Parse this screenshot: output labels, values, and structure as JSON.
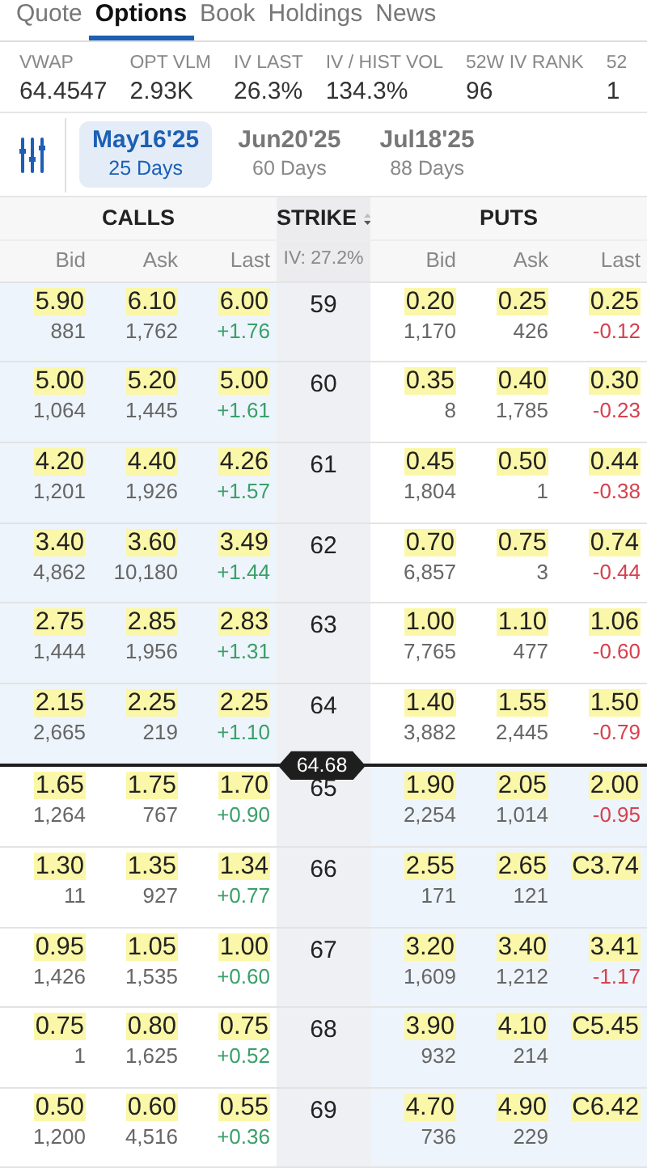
{
  "tabs": [
    {
      "label": "Quote",
      "selected": false
    },
    {
      "label": "Options",
      "selected": true
    },
    {
      "label": "Book",
      "selected": false
    },
    {
      "label": "Holdings",
      "selected": false
    },
    {
      "label": "News",
      "selected": false
    }
  ],
  "stats": [
    {
      "label": "VWAP",
      "value": "64.4547"
    },
    {
      "label": "OPT VLM",
      "value": "2.93K"
    },
    {
      "label": "IV LAST",
      "value": "26.3%"
    },
    {
      "label": "IV / HIST VOL",
      "value": "134.3%"
    },
    {
      "label": "52W IV RANK",
      "value": "96"
    },
    {
      "label": "52",
      "value": "1"
    }
  ],
  "expirations": [
    {
      "date": "May16'25",
      "days": "25 Days",
      "selected": true
    },
    {
      "date": "Jun20'25",
      "days": "60 Days",
      "selected": false
    },
    {
      "date": "Jul18'25",
      "days": "88 Days",
      "selected": false
    }
  ],
  "chain": {
    "calls_label": "CALLS",
    "strike_label": "STRIKE",
    "puts_label": "PUTS",
    "call_columns": [
      "Bid",
      "Ask",
      "Last"
    ],
    "iv": "IV: 27.2%",
    "put_columns": [
      "Bid",
      "Ask",
      "Last"
    ],
    "rows": [
      {
        "strike": "59",
        "call": {
          "bid": "5.90",
          "ask": "6.10",
          "last": "6.00",
          "bid_size": "881",
          "ask_size": "1,762",
          "change": {
            "text": "+1.76",
            "color": "#3aa06a"
          },
          "in_the_money": true
        },
        "put": {
          "bid": "0.20",
          "ask": "0.25",
          "last": "0.25",
          "bid_size": "1,170",
          "ask_size": "426",
          "change": {
            "text": "-0.12",
            "color": "#d6424f"
          },
          "in_the_money": false
        }
      },
      {
        "strike": "60",
        "call": {
          "bid": "5.00",
          "ask": "5.20",
          "last": "5.00",
          "bid_size": "1,064",
          "ask_size": "1,445",
          "change": {
            "text": "+1.61",
            "color": "#3aa06a"
          },
          "in_the_money": true
        },
        "put": {
          "bid": "0.35",
          "ask": "0.40",
          "last": "0.30",
          "bid_size": "8",
          "ask_size": "1,785",
          "change": {
            "text": "-0.23",
            "color": "#d6424f"
          },
          "in_the_money": false
        }
      },
      {
        "strike": "61",
        "call": {
          "bid": "4.20",
          "ask": "4.40",
          "last": "4.26",
          "bid_size": "1,201",
          "ask_size": "1,926",
          "change": {
            "text": "+1.57",
            "color": "#3aa06a"
          },
          "in_the_money": true
        },
        "put": {
          "bid": "0.45",
          "ask": "0.50",
          "last": "0.44",
          "bid_size": "1,804",
          "ask_size": "1",
          "change": {
            "text": "-0.38",
            "color": "#d6424f"
          },
          "in_the_money": false
        }
      },
      {
        "strike": "62",
        "call": {
          "bid": "3.40",
          "ask": "3.60",
          "last": "3.49",
          "bid_size": "4,862",
          "ask_size": "10,180",
          "change": {
            "text": "+1.44",
            "color": "#3aa06a"
          },
          "in_the_money": true
        },
        "put": {
          "bid": "0.70",
          "ask": "0.75",
          "last": "0.74",
          "bid_size": "6,857",
          "ask_size": "3",
          "change": {
            "text": "-0.44",
            "color": "#d6424f"
          },
          "in_the_money": false
        }
      },
      {
        "strike": "63",
        "call": {
          "bid": "2.75",
          "ask": "2.85",
          "last": "2.83",
          "bid_size": "1,444",
          "ask_size": "1,956",
          "change": {
            "text": "+1.31",
            "color": "#3aa06a"
          },
          "in_the_money": true
        },
        "put": {
          "bid": "1.00",
          "ask": "1.10",
          "last": "1.06",
          "bid_size": "7,765",
          "ask_size": "477",
          "change": {
            "text": "-0.60",
            "color": "#d6424f"
          },
          "in_the_money": false
        }
      },
      {
        "strike": "64",
        "price_line": "64.68",
        "call": {
          "bid": "2.15",
          "ask": "2.25",
          "last": "2.25",
          "bid_size": "2,665",
          "ask_size": "219",
          "change": {
            "text": "+1.10",
            "color": "#3aa06a"
          },
          "in_the_money": true
        },
        "put": {
          "bid": "1.40",
          "ask": "1.55",
          "last": "1.50",
          "bid_size": "3,882",
          "ask_size": "2,445",
          "change": {
            "text": "-0.79",
            "color": "#d6424f"
          },
          "in_the_money": false
        }
      },
      {
        "strike": "65",
        "call": {
          "bid": "1.65",
          "ask": "1.75",
          "last": "1.70",
          "bid_size": "1,264",
          "ask_size": "767",
          "change": {
            "text": "+0.90",
            "color": "#3aa06a"
          },
          "in_the_money": false
        },
        "put": {
          "bid": "1.90",
          "ask": "2.05",
          "last": "2.00",
          "bid_size": "2,254",
          "ask_size": "1,014",
          "change": {
            "text": "-0.95",
            "color": "#d6424f"
          },
          "in_the_money": true
        }
      },
      {
        "strike": "66",
        "call": {
          "bid": "1.30",
          "ask": "1.35",
          "last": "1.34",
          "bid_size": "11",
          "ask_size": "927",
          "change": {
            "text": "+0.77",
            "color": "#3aa06a"
          },
          "in_the_money": false
        },
        "put": {
          "bid": "2.55",
          "ask": "2.65",
          "last": "C3.74",
          "bid_size": "171",
          "ask_size": "121",
          "in_the_money": true
        }
      },
      {
        "strike": "67",
        "call": {
          "bid": "0.95",
          "ask": "1.05",
          "last": "1.00",
          "bid_size": "1,426",
          "ask_size": "1,535",
          "change": {
            "text": "+0.60",
            "color": "#3aa06a"
          },
          "in_the_money": false
        },
        "put": {
          "bid": "3.20",
          "ask": "3.40",
          "last": "3.41",
          "bid_size": "1,609",
          "ask_size": "1,212",
          "change": {
            "text": "-1.17",
            "color": "#d6424f"
          },
          "in_the_money": true
        }
      },
      {
        "strike": "68",
        "call": {
          "bid": "0.75",
          "ask": "0.80",
          "last": "0.75",
          "bid_size": "1",
          "ask_size": "1,625",
          "change": {
            "text": "+0.52",
            "color": "#3aa06a"
          },
          "in_the_money": false
        },
        "put": {
          "bid": "3.90",
          "ask": "4.10",
          "last": "C5.45",
          "bid_size": "932",
          "ask_size": "214",
          "in_the_money": true
        }
      },
      {
        "strike": "69",
        "call": {
          "bid": "0.50",
          "ask": "0.60",
          "last": "0.55",
          "bid_size": "1,200",
          "ask_size": "4,516",
          "change": {
            "text": "+0.36",
            "color": "#3aa06a"
          },
          "in_the_money": false
        },
        "put": {
          "bid": "4.70",
          "ask": "4.90",
          "last": "C6.42",
          "bid_size": "736",
          "ask_size": "229",
          "in_the_money": true
        }
      }
    ]
  }
}
